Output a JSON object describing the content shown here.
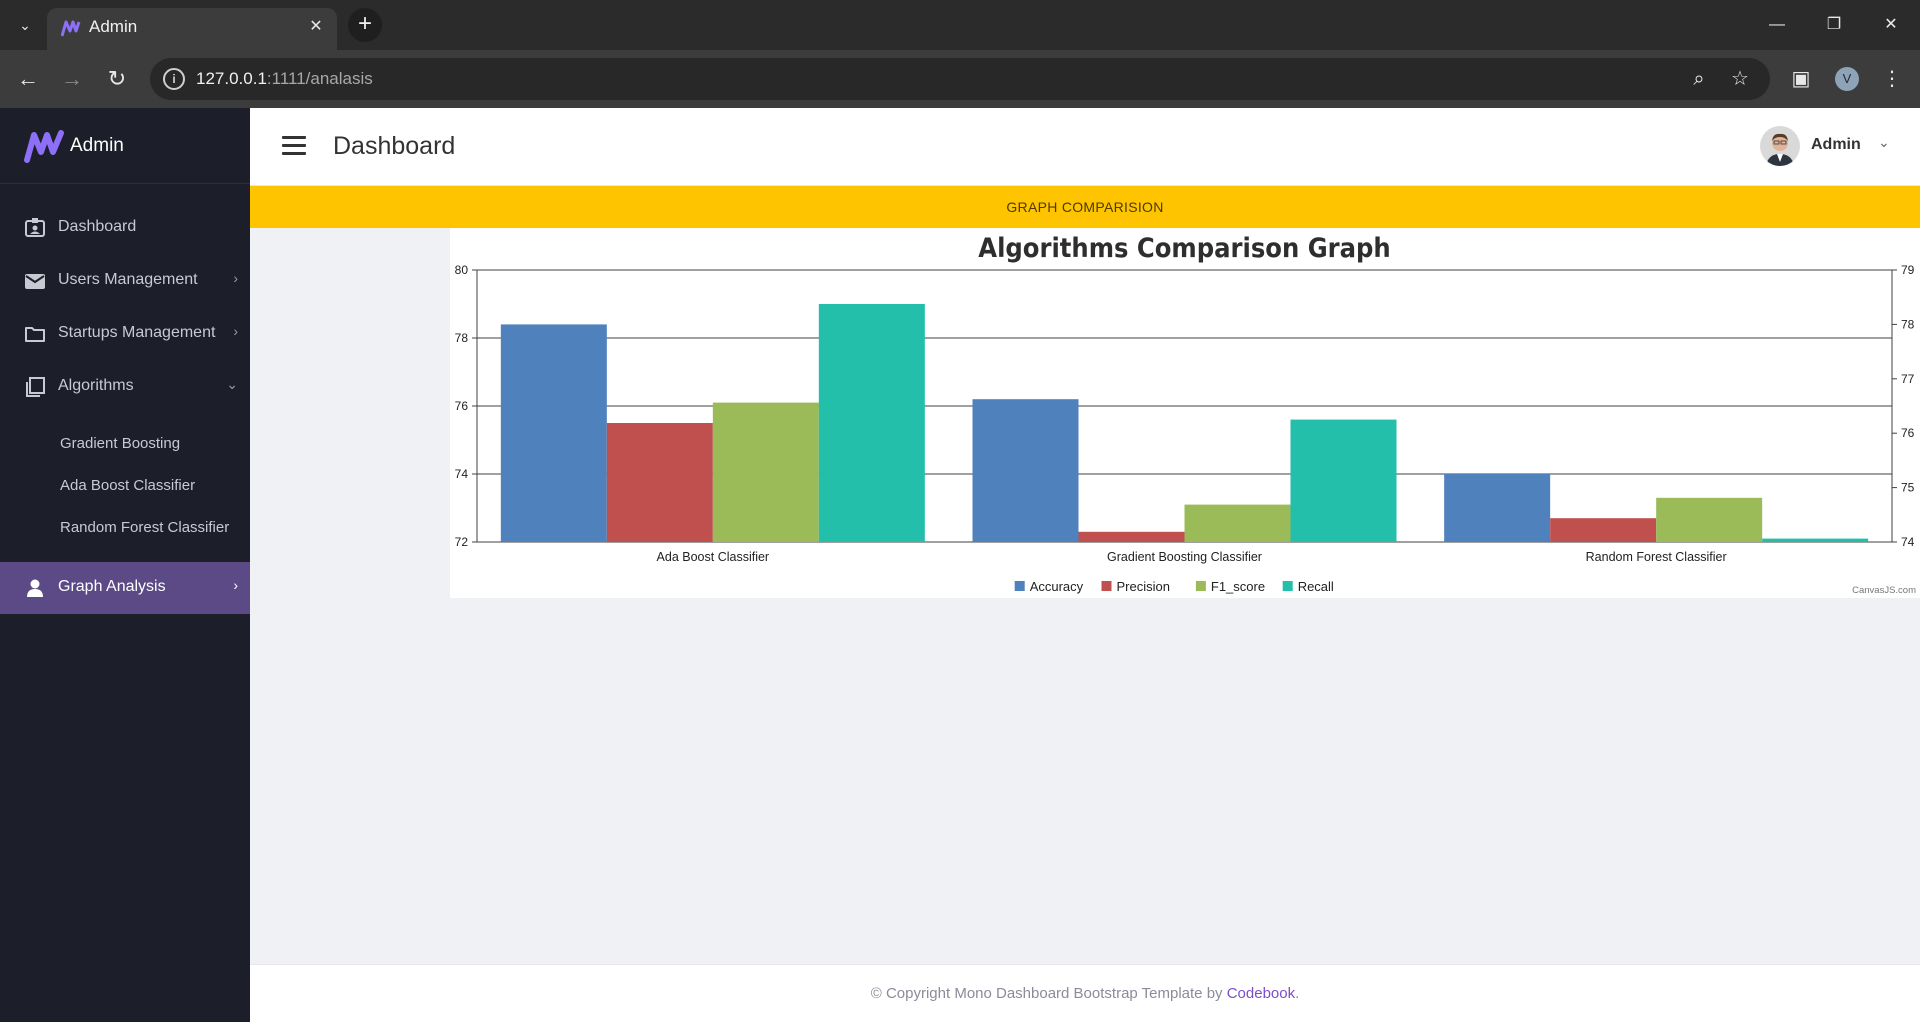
{
  "browser": {
    "tab_title": "Admin",
    "url_host": "127.0.0.1",
    "url_rest": ":1111/analasis",
    "profile_initial": "V"
  },
  "sidebar": {
    "brand": "Admin",
    "items": [
      {
        "label": "Dashboard"
      },
      {
        "label": "Users Management"
      },
      {
        "label": "Startups Management"
      },
      {
        "label": "Algorithms"
      },
      {
        "label": "Graph Analysis"
      }
    ],
    "sub_items": [
      {
        "label": "Gradient Boosting"
      },
      {
        "label": "Ada Boost Classifier"
      },
      {
        "label": "Random Forest Classifier"
      }
    ]
  },
  "header": {
    "title": "Dashboard",
    "user": "Admin"
  },
  "banner": {
    "text": "GRAPH COMPARISION"
  },
  "chart_data": {
    "type": "bar",
    "title": "Algorithms Comparison Graph",
    "categories": [
      "Ada Boost Classifier",
      "Gradient Boosting Classifier",
      "Random Forest Classifier"
    ],
    "series": [
      {
        "name": "Accuracy",
        "values": [
          78.4,
          76.2,
          74.0
        ],
        "color": "#4f81bc"
      },
      {
        "name": "Precision",
        "values": [
          75.5,
          72.3,
          72.7
        ],
        "color": "#c0504e"
      },
      {
        "name": "F1_score",
        "values": [
          76.1,
          73.1,
          73.3
        ],
        "color": "#9bbb58"
      },
      {
        "name": "Recall",
        "values": [
          79.0,
          75.6,
          72.1
        ],
        "color": "#23bfaa"
      }
    ],
    "ylim": [
      72,
      80
    ],
    "y_ticks": [
      "72",
      "74",
      "76",
      "78",
      "80"
    ],
    "y2_ticks": [
      "74",
      "75",
      "76",
      "77",
      "78",
      "79"
    ],
    "credit": "CanvasJS.com",
    "legend_position": "bottom"
  },
  "footer": {
    "prefix": "© Copyright Mono Dashboard Bootstrap Template by ",
    "link": "Codebook",
    "suffix": "."
  }
}
